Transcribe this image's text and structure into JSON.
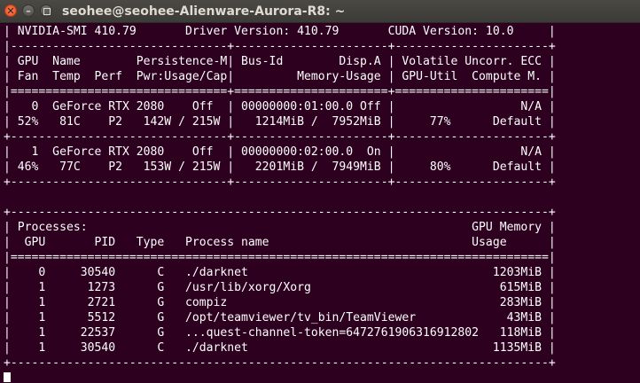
{
  "window": {
    "title": "seohee@seohee-Alienware-Aurora-R8: ~",
    "close_glyph": "✕",
    "minimize_glyph": "–"
  },
  "terminal": {
    "lines": [
      "| NVIDIA-SMI 410.79       Driver Version: 410.79       CUDA Version: 10.0     |",
      "|-------------------------------+----------------------+----------------------+",
      "| GPU  Name        Persistence-M| Bus-Id        Disp.A | Volatile Uncorr. ECC |",
      "| Fan  Temp  Perf  Pwr:Usage/Cap|         Memory-Usage | GPU-Util  Compute M. |",
      "|===============================+======================+======================|",
      "|   0  GeForce RTX 2080    Off  | 00000000:01:00.0 Off |                  N/A |",
      "| 52%   81C    P2   142W / 215W |   1214MiB /  7952MiB |     77%      Default |",
      "+-------------------------------+----------------------+----------------------+",
      "|   1  GeForce RTX 2080    Off  | 00000000:02:00.0  On |                  N/A |",
      "| 46%   77C    P2   153W / 215W |   2201MiB /  7949MiB |     80%      Default |",
      "+-------------------------------+----------------------+----------------------+",
      "",
      "+-----------------------------------------------------------------------------+",
      "| Processes:                                                       GPU Memory |",
      "|  GPU       PID   Type   Process name                             Usage      |",
      "|=============================================================================|",
      "|    0     30540      C   ./darknet                                   1203MiB |",
      "|    1      1273      G   /usr/lib/xorg/Xorg                           615MiB |",
      "|    1      2721      G   compiz                                       283MiB |",
      "|    1      5512      G   /opt/teamviewer/tv_bin/TeamViewer             43MiB |",
      "|    1     22537      G   ...quest-channel-token=6472761906316912802   118MiB |",
      "|    1     30540      C   ./darknet                                   1135MiB |",
      "+-----------------------------------------------------------------------------+"
    ]
  }
}
